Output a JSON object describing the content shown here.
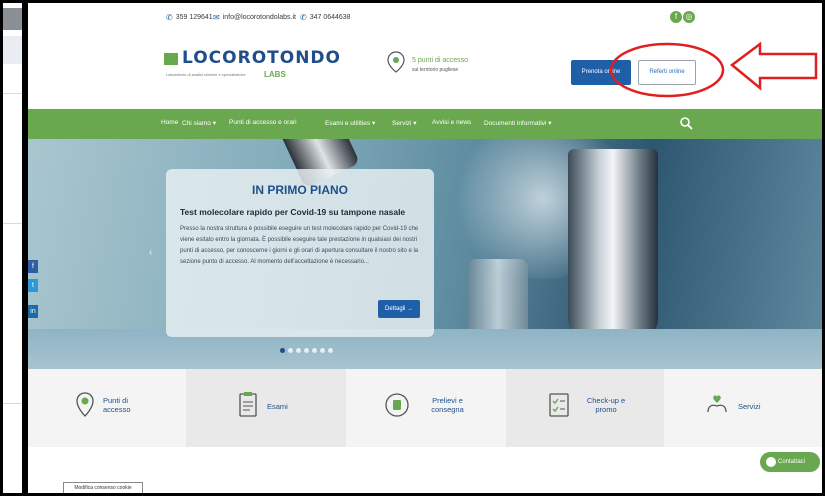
{
  "topbar": {
    "phone": "359 129641",
    "email": "info@locorotondolabs.it",
    "mobile": "347 0644638"
  },
  "header": {
    "logo_title": "LOCOROTONDO",
    "logo_subtitle": "Laboratorio di analisi cliniche e specialistiche",
    "logo_labs": "LABS",
    "access_title": "5 punti di accesso",
    "access_subtitle": "sul territorio pugliese",
    "prenota_label": "Prenota online",
    "referti_label": "Referti online"
  },
  "nav": {
    "items": [
      "Home",
      "Chi siamo ▾",
      "Punti di accesso e orari",
      "Esami e utilities ▾",
      "Servizi ▾",
      "Avvisi e news",
      "Documenti informativi ▾"
    ]
  },
  "hero": {
    "title": "IN PRIMO PIANO",
    "subtitle": "Test molecolare rapido per Covid-19 su tampone nasale",
    "body": "Presso la nostra struttura è possibile eseguire un test molecolare rapido per Covid-19 che viene esitato entro la giornata. È possibile eseguire tale prestazione in qualsiasi dei nostri punti di accesso, per conoscerne i giorni e gli orari di apertura consultare il nostro sito e la sezione punto di accesso. Al momento dell'accettazione è necessario...",
    "button_label": "Dettagli →"
  },
  "tiles": [
    {
      "label": "Punti di accesso",
      "icon": "location-pin-icon"
    },
    {
      "label": "Esami",
      "icon": "clipboard-icon"
    },
    {
      "label": "Prelievi e consegna",
      "icon": "syringe-icon"
    },
    {
      "label": "Check-up e promo",
      "icon": "checklist-icon"
    },
    {
      "label": "Servizi",
      "icon": "hand-heart-icon"
    }
  ],
  "footer": {
    "modifica_label": "Modifica consenso cookie",
    "contattaci_label": "Contattaci"
  },
  "side_social": [
    "f",
    "t",
    "in"
  ],
  "colors": {
    "brand_green": "#6aa84f",
    "brand_blue": "#1f4f8a",
    "button_blue": "#1f5fa8",
    "annotation_red": "#e02020"
  }
}
